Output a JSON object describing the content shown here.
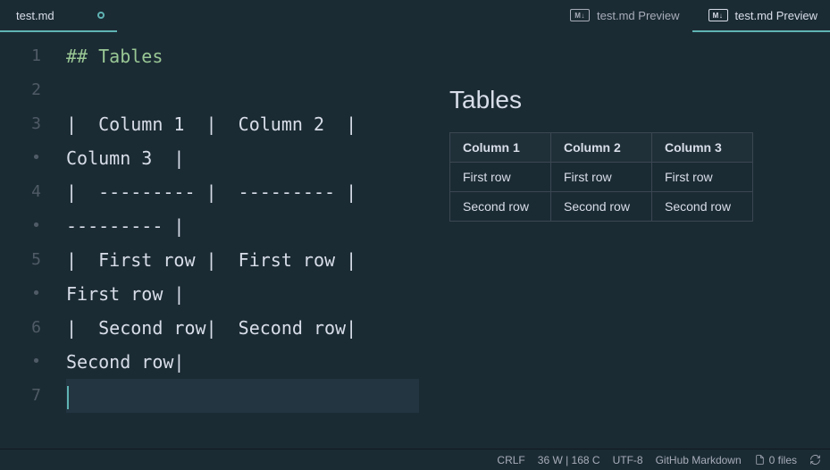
{
  "tabs": {
    "editor": {
      "label": "test.md"
    },
    "preview1": {
      "label": "test.md Preview",
      "badge": "M↓"
    },
    "preview2": {
      "label": "test.md Preview",
      "badge": "M↓"
    }
  },
  "editor": {
    "gutter": [
      "1",
      "2",
      "3",
      "•",
      "4",
      "•",
      "5",
      "•",
      "6",
      "•",
      "7"
    ],
    "lines": [
      {
        "text": "## Tables",
        "cls": "heading"
      },
      {
        "text": "",
        "cls": ""
      },
      {
        "text": "|  Column 1  |  Column 2  |",
        "cls": ""
      },
      {
        "text": "Column 3  |",
        "cls": ""
      },
      {
        "text": "|  --------- |  --------- |",
        "cls": ""
      },
      {
        "text": "--------- |",
        "cls": ""
      },
      {
        "text": "|  First row |  First row |",
        "cls": ""
      },
      {
        "text": "First row |",
        "cls": ""
      },
      {
        "text": "|  Second row|  Second row|",
        "cls": ""
      },
      {
        "text": "Second row|",
        "cls": ""
      },
      {
        "text": "",
        "cls": "current"
      }
    ]
  },
  "preview": {
    "heading": "Tables",
    "headers": [
      "Column 1",
      "Column 2",
      "Column 3"
    ],
    "rows": [
      [
        "First row",
        "First row",
        "First row"
      ],
      [
        "Second row",
        "Second row",
        "Second row"
      ]
    ]
  },
  "statusbar": {
    "lineending": "CRLF",
    "count": "36 W | 168 C",
    "encoding": "UTF-8",
    "grammar": "GitHub Markdown",
    "files": "0 files"
  }
}
